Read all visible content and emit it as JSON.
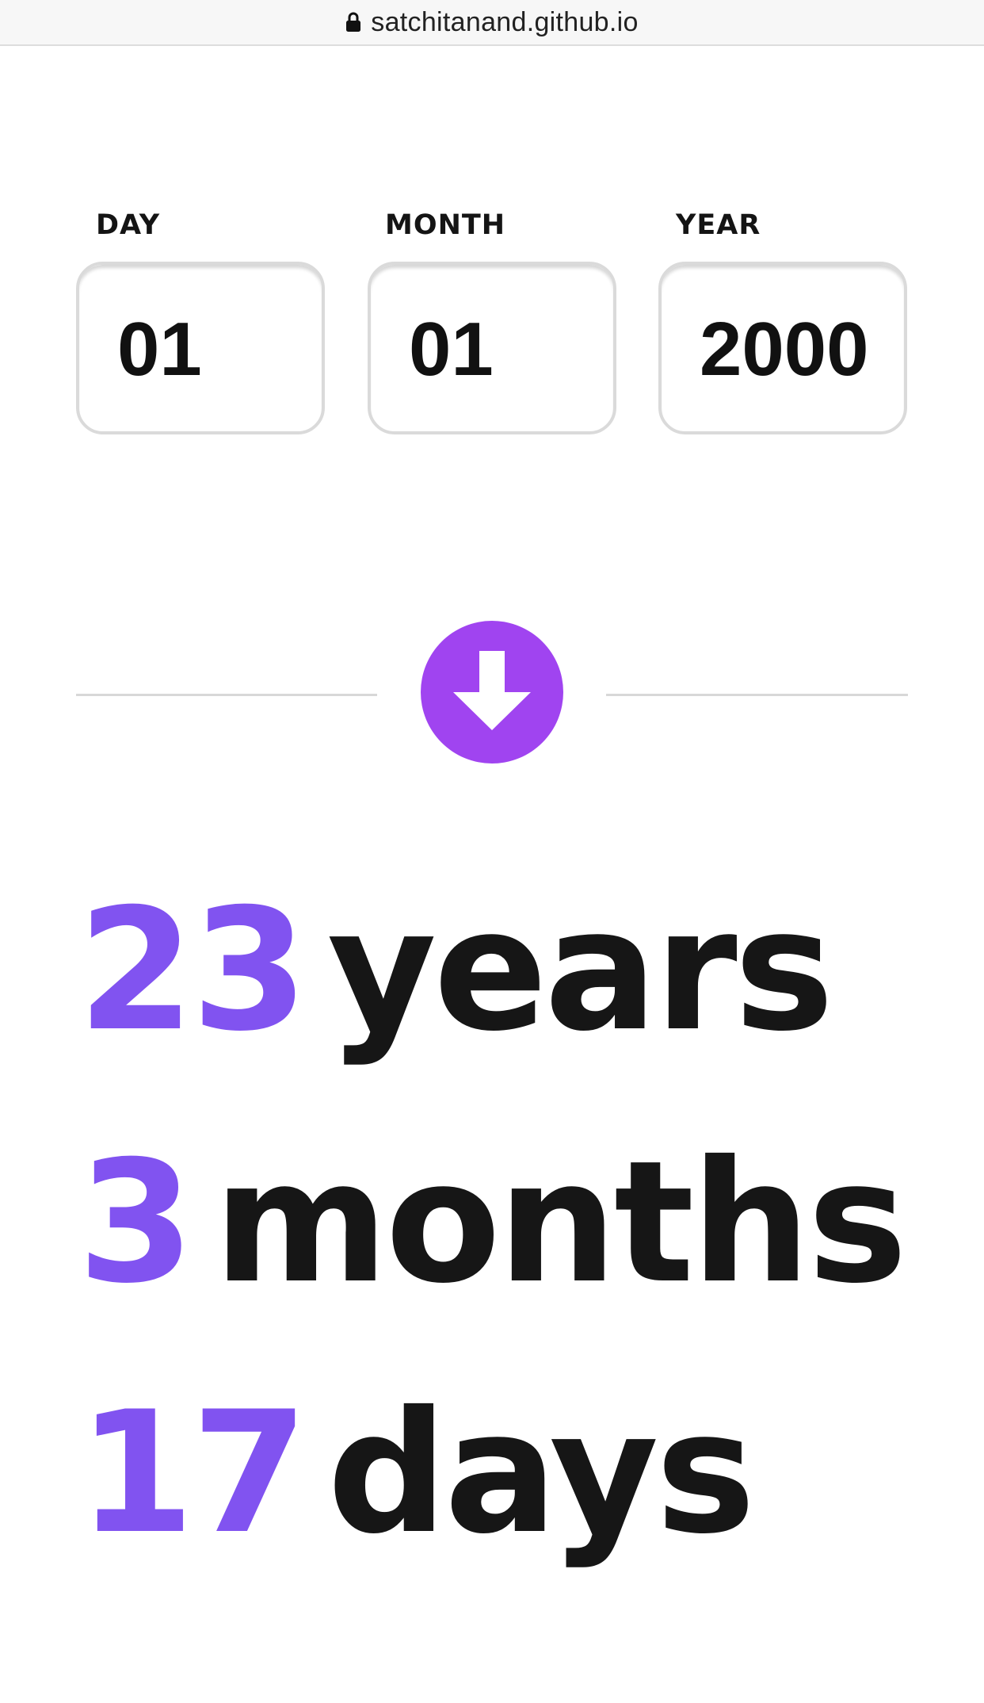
{
  "browser": {
    "url": "satchitanand.github.io",
    "lock_icon": "lock-icon"
  },
  "form": {
    "day": {
      "label": "DAY",
      "value": "01"
    },
    "month": {
      "label": "MONTH",
      "value": "01"
    },
    "year": {
      "label": "YEAR",
      "value": "2000"
    }
  },
  "submit": {
    "icon": "arrow-down-icon",
    "color": "#a044f0"
  },
  "result": {
    "years": {
      "value": "23",
      "unit": "years"
    },
    "months": {
      "value": "3",
      "unit": "months"
    },
    "days": {
      "value": "17",
      "unit": "days"
    }
  },
  "colors": {
    "accent": "#8153f0",
    "text": "#161616",
    "border": "#dadada"
  }
}
